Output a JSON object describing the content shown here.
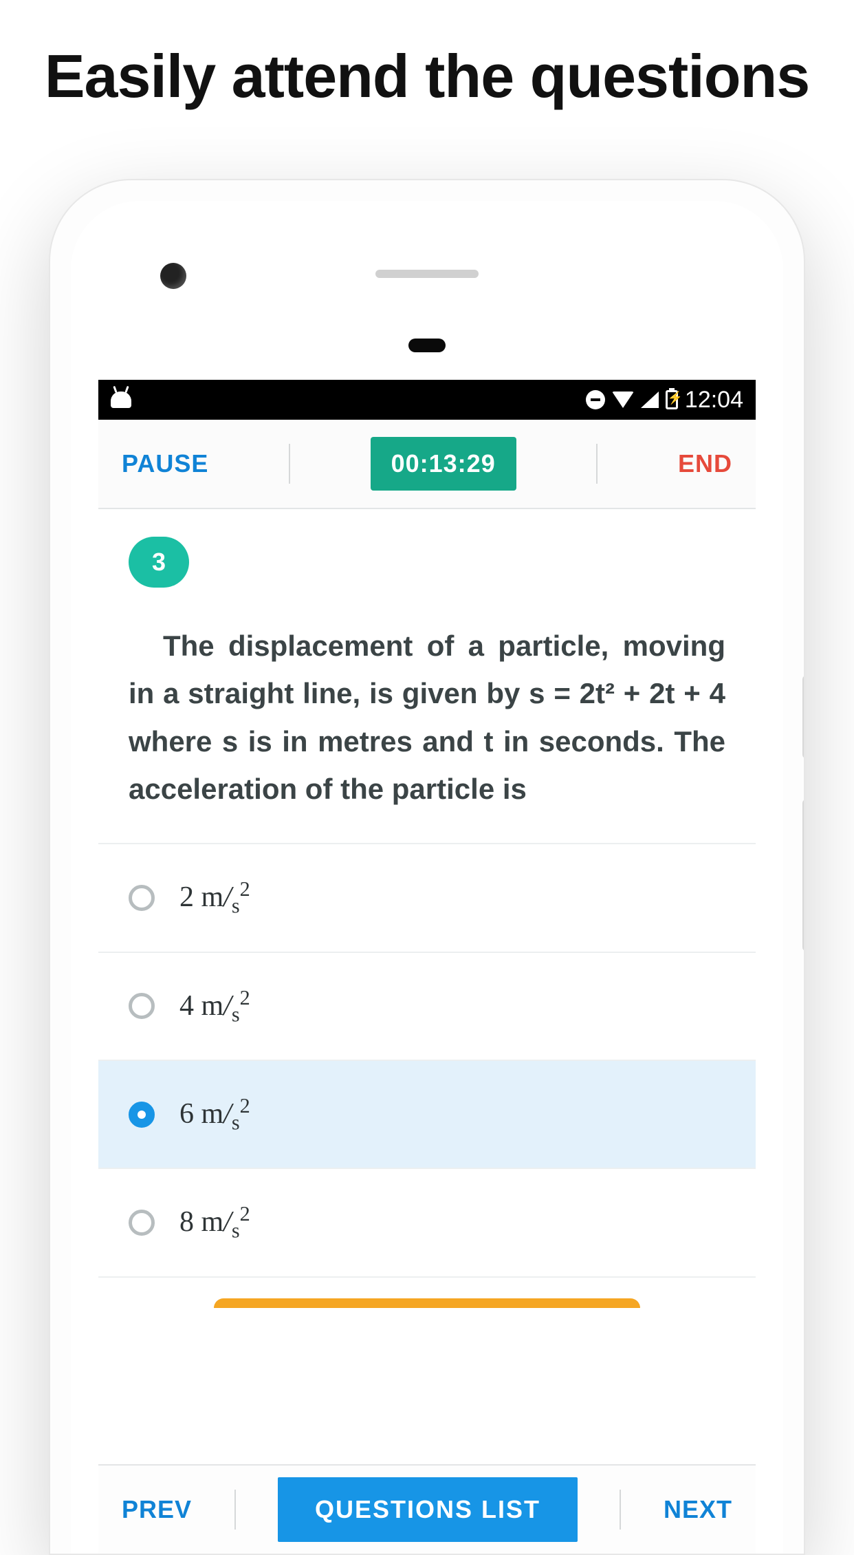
{
  "headline": "Easily attend the questions",
  "statusbar": {
    "time": "12:04"
  },
  "topbar": {
    "pause_label": "PAUSE",
    "timer": "00:13:29",
    "end_label": "END"
  },
  "question": {
    "number": "3",
    "text": "The displacement of a particle, moving in a straight line, is given by s = 2t² + 2t + 4 where s is in metres and t in seconds. The acceleration of the particle is"
  },
  "options": [
    {
      "label": "2 m/s²",
      "selected": false
    },
    {
      "label": "4 m/s²",
      "selected": false
    },
    {
      "label": "6 m/s²",
      "selected": true
    },
    {
      "label": "8 m/s²",
      "selected": false
    }
  ],
  "bottombar": {
    "prev_label": "PREV",
    "list_label": "QUESTIONS LIST",
    "next_label": "NEXT"
  }
}
